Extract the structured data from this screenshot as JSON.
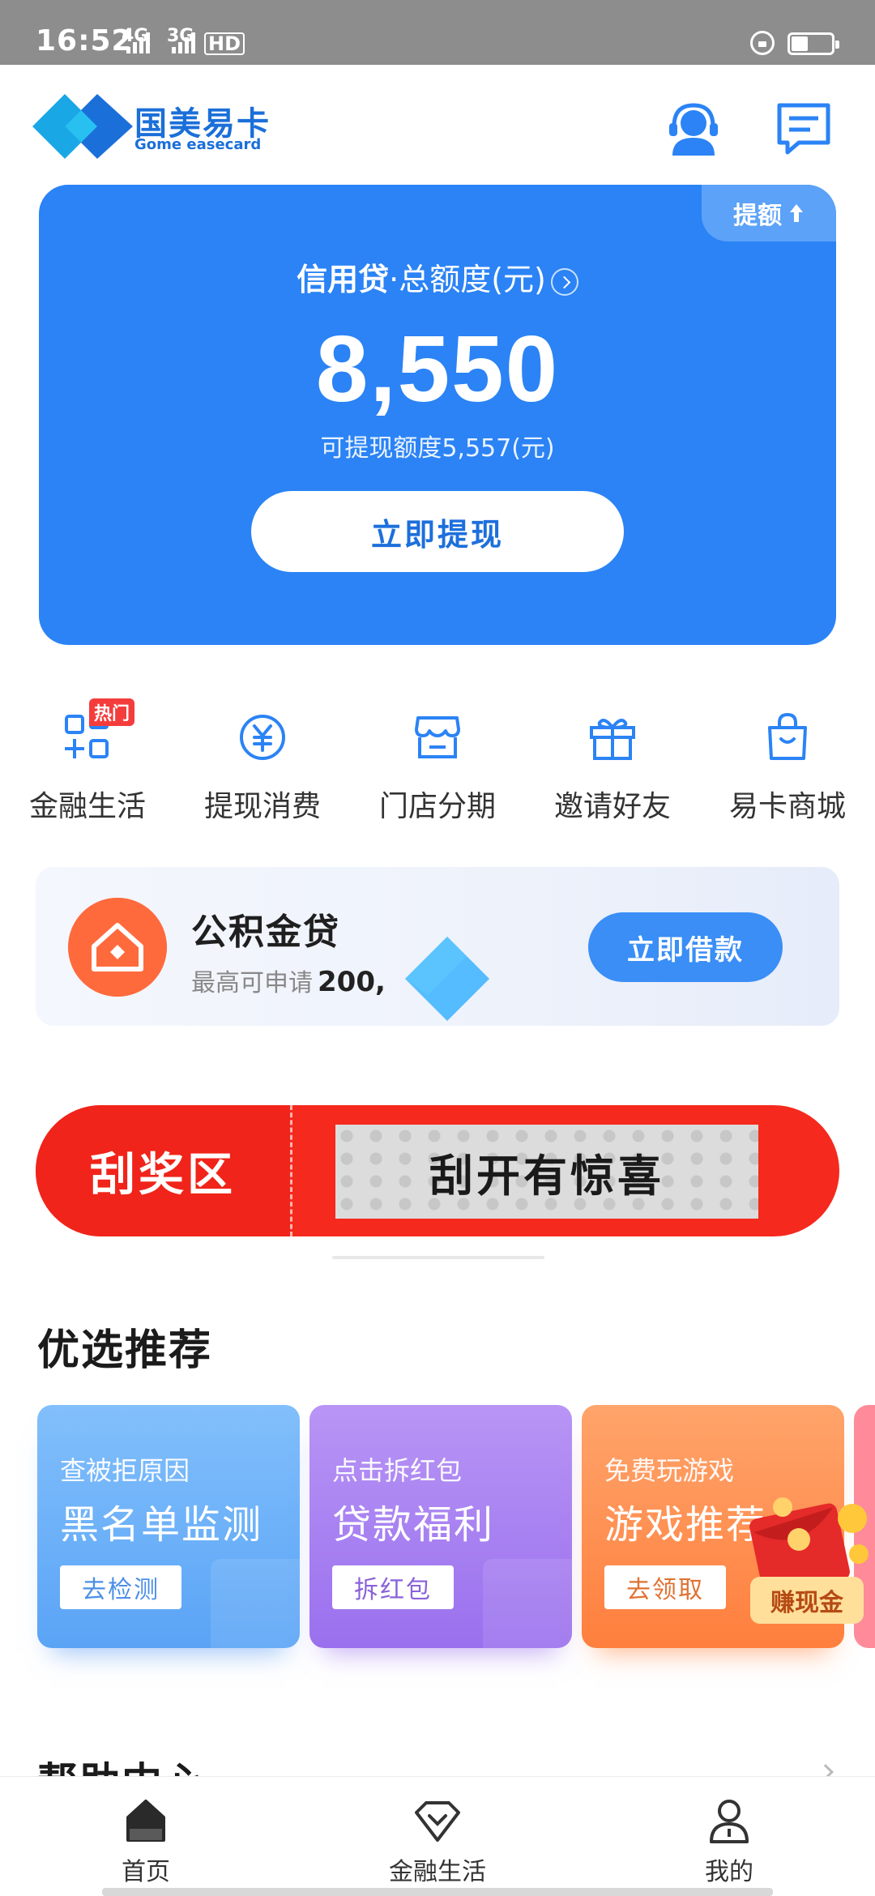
{
  "status_bar": {
    "time": "16:52",
    "network_1": "4G",
    "network_2": "3G",
    "hd": "HD"
  },
  "header": {
    "logo_cn": "国美易卡",
    "logo_en": "Gome easecard",
    "brand_color": "#1b6fd8",
    "icons": [
      "customer-service-icon",
      "message-icon"
    ]
  },
  "credit_card": {
    "raise_label": "提额",
    "title_bold": "信用贷",
    "title_rest": "·总额度(元)",
    "amount": "8,550",
    "available": "可提现额度5,557(元)",
    "button": "立即提现",
    "bg_color": "#2b83f5"
  },
  "quick_nav": {
    "hot_badge": "热门",
    "items": [
      {
        "label": "金融生活",
        "icon": "grid-plus-icon"
      },
      {
        "label": "提现消费",
        "icon": "yuan-coin-icon"
      },
      {
        "label": "门店分期",
        "icon": "store-icon"
      },
      {
        "label": "邀请好友",
        "icon": "gift-icon"
      },
      {
        "label": "易卡商城",
        "icon": "shopping-bag-icon"
      }
    ]
  },
  "fund_loan": {
    "title": "公积金贷",
    "sub_prefix": "最高可申请",
    "sub_amount": "200,",
    "button": "立即借款",
    "icon": "house-icon"
  },
  "scratch": {
    "left_label": "刮奖区",
    "area_label": "刮开有惊喜"
  },
  "recommend": {
    "title": "优选推荐",
    "cards": [
      {
        "top": "查被拒原因",
        "main": "黑名单监测",
        "button": "去检测"
      },
      {
        "top": "点击拆红包",
        "main": "贷款福利",
        "button": "拆红包"
      },
      {
        "top": "免费玩游戏",
        "main": "游戏推荐",
        "button": "去领取"
      }
    ],
    "earn_badge": "赚现金"
  },
  "help": {
    "title": "帮助中心"
  },
  "bottom_nav": {
    "items": [
      {
        "label": "首页",
        "icon": "home-icon"
      },
      {
        "label": "金融生活",
        "icon": "diamond-icon"
      },
      {
        "label": "我的",
        "icon": "user-icon"
      }
    ]
  }
}
